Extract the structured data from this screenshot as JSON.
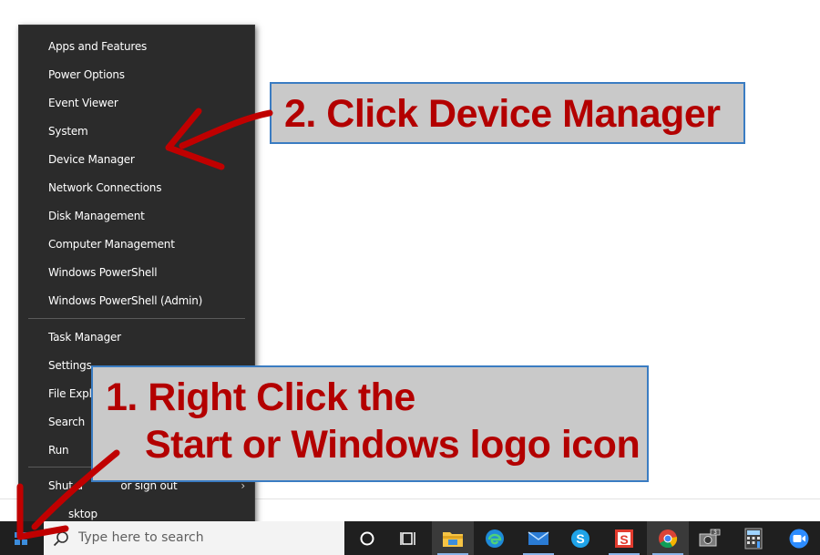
{
  "menu": {
    "items": [
      {
        "label": "Apps and Features"
      },
      {
        "label": "Power Options"
      },
      {
        "label": "Event Viewer"
      },
      {
        "label": "System"
      },
      {
        "label": "Device Manager"
      },
      {
        "label": "Network Connections"
      },
      {
        "label": "Disk Management"
      },
      {
        "label": "Computer Management"
      },
      {
        "label": "Windows PowerShell"
      },
      {
        "label": "Windows PowerShell (Admin)"
      },
      {
        "label": "Task Manager"
      },
      {
        "label": "Settings"
      },
      {
        "label": "File Explo"
      },
      {
        "label": "Search"
      },
      {
        "label": "Run"
      },
      {
        "label": "Shut d"
      },
      {
        "label": "sktop"
      }
    ],
    "shutdown_suffix": "or sign out",
    "submenu_chevron": "›"
  },
  "taskbar": {
    "search_placeholder": "Type here to search",
    "icons": [
      "cortana-icon",
      "task-view-icon",
      "file-explorer-icon",
      "edge-icon",
      "mail-icon",
      "skype-icon",
      "snagit-icon",
      "chrome-icon",
      "camera-app-icon",
      "calculator-icon",
      "zoom-icon"
    ]
  },
  "callouts": {
    "step2": "2. Click Device Manager",
    "step1_line1": "1. Right Click the",
    "step1_line2": "Start or Windows logo icon"
  },
  "colors": {
    "menu_bg": "#2b2b2b",
    "callout_text": "#b30000",
    "callout_border": "#3a7cc2",
    "callout_bg": "#c9c9c9",
    "arrow": "#c00000"
  }
}
